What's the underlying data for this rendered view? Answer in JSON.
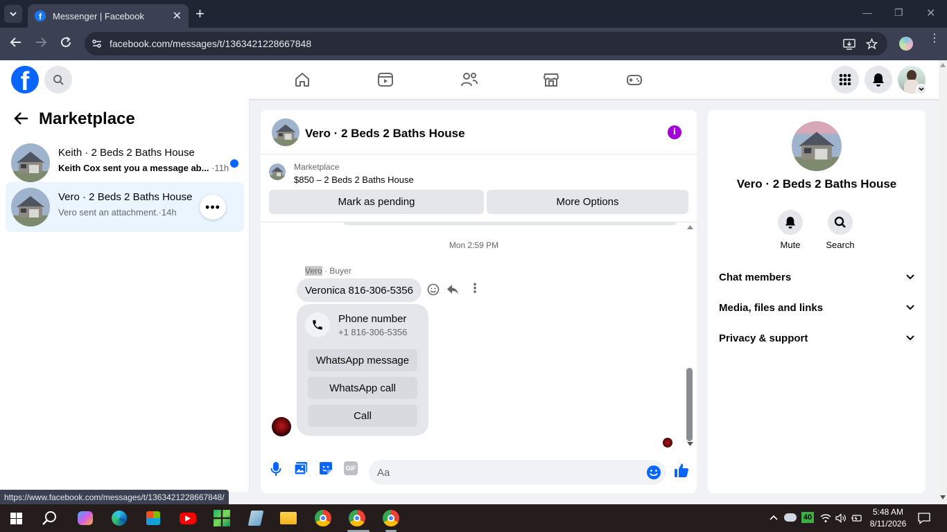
{
  "browser": {
    "tab_title": "Messenger | Facebook",
    "url": "facebook.com/messages/t/1363421228667848",
    "status_url": "https://www.facebook.com/messages/t/1363421228667848/"
  },
  "sidebar": {
    "title": "Marketplace",
    "conversations": [
      {
        "name": "Keith · 2 Beds 2 Baths House",
        "preview": "Keith Cox sent you a message ab...",
        "time": "·11h",
        "unread": true
      },
      {
        "name": "Vero · 2 Beds 2 Baths House",
        "preview": "Vero sent an attachment.",
        "time": "·14h",
        "unread": false
      }
    ]
  },
  "chat": {
    "title": "Vero · 2 Beds 2 Baths House",
    "marketplace_label": "Marketplace",
    "listing": "$850 – 2 Beds 2 Baths House",
    "mark_pending_label": "Mark as pending",
    "more_options_label": "More Options",
    "timestamp": "Mon 2:59 PM",
    "sender_name": "Vero",
    "sender_role": " · Buyer",
    "message_text": "Veronica 816-306-5356",
    "phone_card": {
      "title": "Phone number",
      "number": "+1 816-306-5356",
      "whatsapp_message_label": "WhatsApp message",
      "whatsapp_call_label": "WhatsApp call",
      "call_label": "Call"
    },
    "composer_placeholder": "Aa"
  },
  "info_panel": {
    "name": "Vero · 2 Beds 2 Baths House",
    "mute_label": "Mute",
    "search_label": "Search",
    "sections": [
      "Chat members",
      "Media, files and links",
      "Privacy & support"
    ]
  },
  "taskbar": {
    "time": "5:48 AM",
    "date": "8/11/2026",
    "badge": "40"
  },
  "colors": {
    "fb_blue": "#0866ff",
    "info_purple": "#a400d8",
    "unread_dot": "#0866ff"
  }
}
